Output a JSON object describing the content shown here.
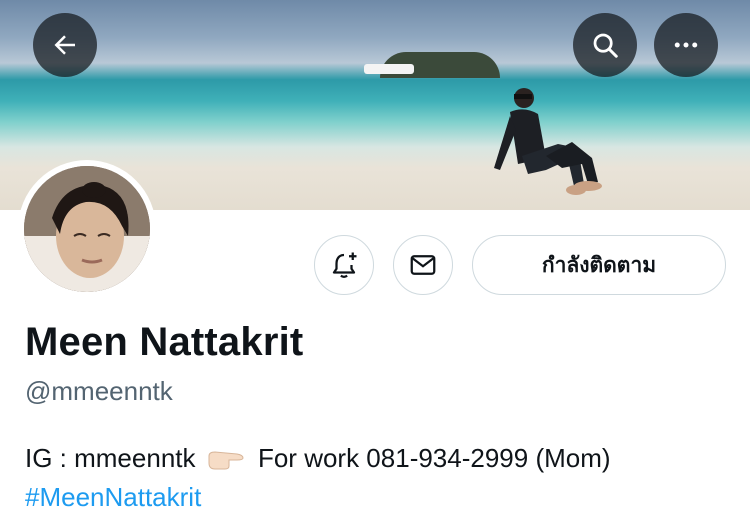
{
  "profile": {
    "name": "Meen Nattakrit",
    "handle": "@mmeenntk",
    "bio_part1": "IG : mmeenntk",
    "bio_part2": "For work 081-934-2999 (Mom)",
    "hashtag": "#MeenNattakrit"
  },
  "actions": {
    "follow_label": "กำลังติดตาม"
  },
  "icons": {
    "back": "arrow-left-icon",
    "search": "search-icon",
    "more": "more-icon",
    "notify": "bell-plus-icon",
    "message": "envelope-icon",
    "pointing": "pointing-right-emoji"
  },
  "colors": {
    "link": "#1d9bf0",
    "text": "#0f1419",
    "secondary": "#536471",
    "border": "#cfd9de"
  }
}
